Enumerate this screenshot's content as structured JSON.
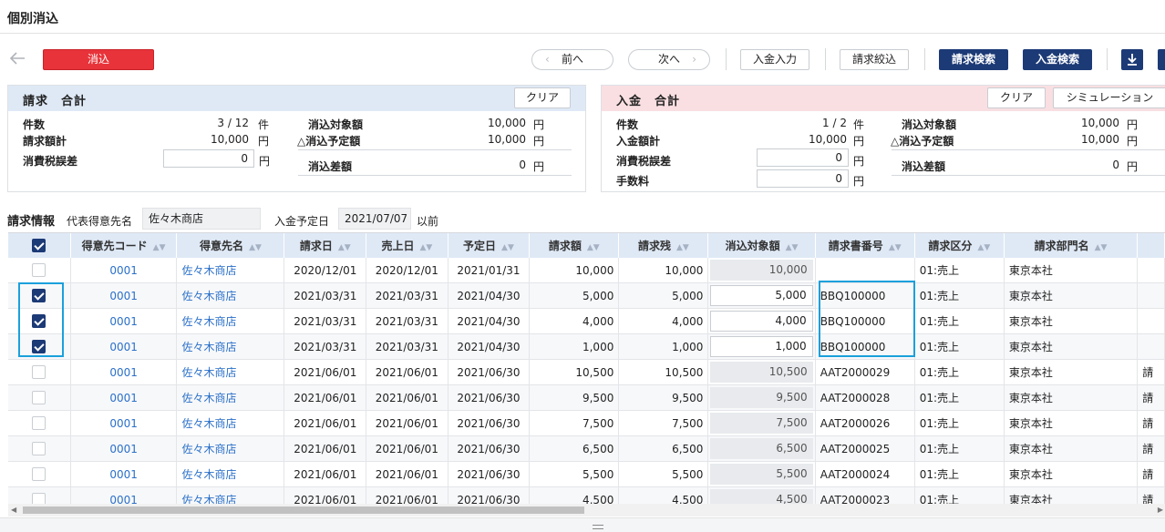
{
  "page_title": "個別消込",
  "toolbar": {
    "reconcile_label": "消込",
    "prev_label": "前へ",
    "next_label": "次へ",
    "payment_entry_label": "入金入力",
    "invoice_filter_label": "請求絞込",
    "invoice_search_label": "請求検索",
    "payment_search_label": "入金検索"
  },
  "invoice_summary": {
    "title": "請求　合計",
    "clear_label": "クリア",
    "count_label": "件数",
    "count_value": "3 / 12",
    "count_unit": "件",
    "amount_label": "請求額計",
    "amount_value": "10,000",
    "tax_diff_label": "消費税誤差",
    "tax_diff_value": "0",
    "target_label": "消込対象額",
    "target_value": "10,000",
    "planned_label": "△消込予定額",
    "planned_value": "10,000",
    "diff_label": "消込差額",
    "diff_value": "0",
    "yen": "円"
  },
  "payment_summary": {
    "title": "入金　合計",
    "clear_label": "クリア",
    "simulation_label": "シミュレーション",
    "count_label": "件数",
    "count_value": "1 / 2",
    "count_unit": "件",
    "amount_label": "入金額計",
    "amount_value": "10,000",
    "tax_diff_label": "消費税誤差",
    "tax_diff_value": "0",
    "fee_label": "手数料",
    "fee_value": "0",
    "target_label": "消込対象額",
    "target_value": "10,000",
    "planned_label": "△消込予定額",
    "planned_value": "10,000",
    "diff_label": "消込差額",
    "diff_value": "0",
    "yen": "円"
  },
  "filter": {
    "section_label": "請求情報",
    "customer_label": "代表得意先名",
    "customer_value": "佐々木商店",
    "due_label": "入金予定日",
    "due_value": "2021/07/07",
    "due_suffix": "以前"
  },
  "table": {
    "columns": [
      "得意先コード",
      "得意先名",
      "請求日",
      "売上日",
      "予定日",
      "請求額",
      "請求残",
      "消込対象額",
      "請求書番号",
      "請求区分",
      "請求部門名"
    ],
    "header_checked": true,
    "rows": [
      {
        "checked": false,
        "code": "0001",
        "name": "佐々木商店",
        "inv_date": "2020/12/01",
        "sale_date": "2020/12/01",
        "due_date": "2021/01/31",
        "amount": "10,000",
        "balance": "10,000",
        "target": "10,000",
        "inv_no": "",
        "type": "01:売上",
        "dept": "東京本社",
        "extra": ""
      },
      {
        "checked": true,
        "code": "0001",
        "name": "佐々木商店",
        "inv_date": "2021/03/31",
        "sale_date": "2021/03/31",
        "due_date": "2021/04/30",
        "amount": "5,000",
        "balance": "5,000",
        "target": "5,000",
        "inv_no": "BBQ100000",
        "type": "01:売上",
        "dept": "東京本社",
        "extra": ""
      },
      {
        "checked": true,
        "code": "0001",
        "name": "佐々木商店",
        "inv_date": "2021/03/31",
        "sale_date": "2021/03/31",
        "due_date": "2021/04/30",
        "amount": "4,000",
        "balance": "4,000",
        "target": "4,000",
        "inv_no": "BBQ100000",
        "type": "01:売上",
        "dept": "東京本社",
        "extra": ""
      },
      {
        "checked": true,
        "code": "0001",
        "name": "佐々木商店",
        "inv_date": "2021/03/31",
        "sale_date": "2021/03/31",
        "due_date": "2021/04/30",
        "amount": "1,000",
        "balance": "1,000",
        "target": "1,000",
        "inv_no": "BBQ100000",
        "type": "01:売上",
        "dept": "東京本社",
        "extra": ""
      },
      {
        "checked": false,
        "code": "0001",
        "name": "佐々木商店",
        "inv_date": "2021/06/01",
        "sale_date": "2021/06/01",
        "due_date": "2021/06/30",
        "amount": "10,500",
        "balance": "10,500",
        "target": "10,500",
        "inv_no": "AAT2000029",
        "type": "01:売上",
        "dept": "東京本社",
        "extra": "請"
      },
      {
        "checked": false,
        "code": "0001",
        "name": "佐々木商店",
        "inv_date": "2021/06/01",
        "sale_date": "2021/06/01",
        "due_date": "2021/06/30",
        "amount": "9,500",
        "balance": "9,500",
        "target": "9,500",
        "inv_no": "AAT2000028",
        "type": "01:売上",
        "dept": "東京本社",
        "extra": "請"
      },
      {
        "checked": false,
        "code": "0001",
        "name": "佐々木商店",
        "inv_date": "2021/06/01",
        "sale_date": "2021/06/01",
        "due_date": "2021/06/30",
        "amount": "7,500",
        "balance": "7,500",
        "target": "7,500",
        "inv_no": "AAT2000026",
        "type": "01:売上",
        "dept": "東京本社",
        "extra": "請"
      },
      {
        "checked": false,
        "code": "0001",
        "name": "佐々木商店",
        "inv_date": "2021/06/01",
        "sale_date": "2021/06/01",
        "due_date": "2021/06/30",
        "amount": "6,500",
        "balance": "6,500",
        "target": "6,500",
        "inv_no": "AAT2000025",
        "type": "01:売上",
        "dept": "東京本社",
        "extra": "請"
      },
      {
        "checked": false,
        "code": "0001",
        "name": "佐々木商店",
        "inv_date": "2021/06/01",
        "sale_date": "2021/06/01",
        "due_date": "2021/06/30",
        "amount": "5,500",
        "balance": "5,500",
        "target": "5,500",
        "inv_no": "AAT2000024",
        "type": "01:売上",
        "dept": "東京本社",
        "extra": "請"
      },
      {
        "checked": false,
        "code": "0001",
        "name": "佐々木商店",
        "inv_date": "2021/06/01",
        "sale_date": "2021/06/01",
        "due_date": "2021/06/30",
        "amount": "4,500",
        "balance": "4,500",
        "target": "4,500",
        "inv_no": "AAT2000023",
        "type": "01:売上",
        "dept": "東京本社",
        "extra": "請"
      }
    ]
  },
  "colors": {
    "navy": "#1c3a76",
    "red": "#e8333a",
    "link": "#2b70c9",
    "highlight": "#1aa0dc",
    "header_blue": "#dfe9f6",
    "header_pink": "#f9dfe2"
  },
  "icons": [
    "back-arrow-icon",
    "chevron-left-icon",
    "chevron-right-icon",
    "download-icon",
    "sort-icon",
    "checkbox-icon"
  ]
}
